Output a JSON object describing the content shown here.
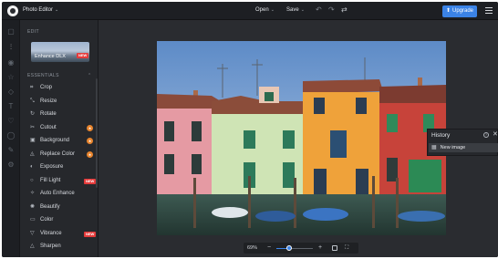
{
  "topbar": {
    "app_title": "Photo Editor",
    "open_label": "Open",
    "save_label": "Save",
    "upgrade_label": "Upgrade"
  },
  "panel": {
    "edit_section": "EDIT",
    "enhance_card_label": "Enhance DLX",
    "essentials_section": "ESSENTIALS",
    "new_badge": "NEW",
    "tools": [
      {
        "label": "Crop",
        "icon": "crop-icon",
        "glyph": "⌗"
      },
      {
        "label": "Resize",
        "icon": "resize-icon",
        "glyph": "⤡"
      },
      {
        "label": "Rotate",
        "icon": "rotate-icon",
        "glyph": "↻"
      },
      {
        "label": "Cutout",
        "icon": "scissors-icon",
        "glyph": "✂",
        "premium": true
      },
      {
        "label": "Background",
        "icon": "background-icon",
        "glyph": "▣",
        "premium": true
      },
      {
        "label": "Replace Color",
        "icon": "bucket-icon",
        "glyph": "◬",
        "premium": true
      },
      {
        "label": "Exposure",
        "icon": "exposure-icon",
        "glyph": "◐"
      },
      {
        "label": "Fill Light",
        "icon": "bulb-icon",
        "glyph": "○",
        "new": true
      },
      {
        "label": "Auto Enhance",
        "icon": "sparkle-icon",
        "glyph": "✧"
      },
      {
        "label": "Beautify",
        "icon": "beautify-icon",
        "glyph": "✺"
      },
      {
        "label": "Color",
        "icon": "color-icon",
        "glyph": "▭"
      },
      {
        "label": "Vibrance",
        "icon": "vibrance-icon",
        "glyph": "▽",
        "new": true
      },
      {
        "label": "Sharpen",
        "icon": "sharpen-icon",
        "glyph": "△"
      }
    ]
  },
  "zoom": {
    "value": "69%",
    "level_fraction": 0.35
  },
  "history": {
    "title": "History",
    "items": [
      {
        "label": "New image"
      }
    ]
  },
  "colors": {
    "accent": "#3b83e6",
    "premium": "#e8852e",
    "new_badge": "#e53b3b"
  }
}
